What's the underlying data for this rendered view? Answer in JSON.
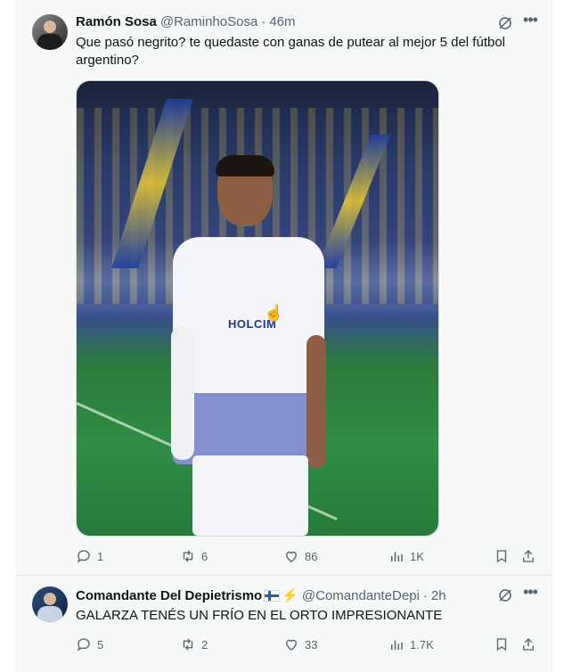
{
  "tweets": [
    {
      "author": {
        "name": "Ramón Sosa",
        "handle": "@RaminhoSosa"
      },
      "time": "46m",
      "dot": "·",
      "text": "Que pasó negrito? te quedaste con ganas de putear al mejor 5 del fútbol argentino?",
      "media": {
        "sponsor": "HOLCIM"
      },
      "stats": {
        "replies": "1",
        "retweets": "6",
        "likes": "86",
        "views": "1K"
      }
    },
    {
      "author": {
        "name": "Comandante Del Depietrismo",
        "handle": "@ComandanteDepi"
      },
      "time": "2h",
      "dot": "·",
      "text": "GALARZA TENÉS UN FRÍO EN EL ORTO IMPRESIONANTE",
      "stats": {
        "replies": "5",
        "retweets": "2",
        "likes": "33",
        "views": "1.7K"
      }
    }
  ],
  "icons": {
    "more": "more-icon",
    "grok": "grok-icon",
    "reply": "reply-icon",
    "retweet": "retweet-icon",
    "like": "heart-icon",
    "views": "views-icon",
    "bookmark": "bookmark-icon",
    "share": "share-icon"
  },
  "colors": {
    "text": "#0f1419",
    "muted": "#536471",
    "background": "#f7f9f9"
  }
}
